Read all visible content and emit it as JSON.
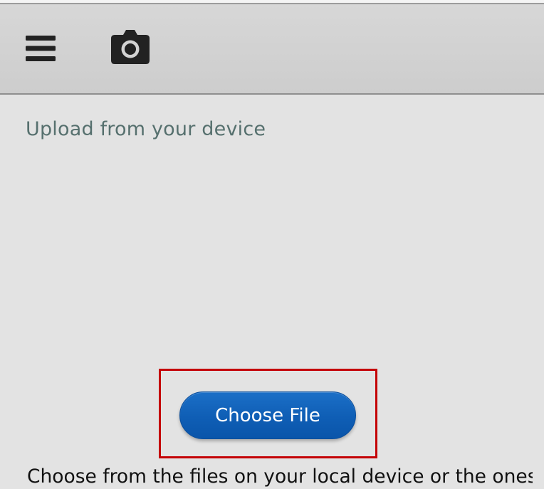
{
  "toolbar": {
    "menu_icon": "hamburger-menu-icon",
    "camera_icon": "camera-icon"
  },
  "upload": {
    "title": "Upload from your device",
    "button_label": "Choose File",
    "description": "Choose from the files on your local device or the ones"
  },
  "colors": {
    "background": "#e3e3e3",
    "toolbar": "#d2d2d2",
    "icon": "#222222",
    "title_text": "#56706e",
    "button": "#0f5eb5",
    "button_text": "#ffffff",
    "highlight_border": "#c40006"
  }
}
